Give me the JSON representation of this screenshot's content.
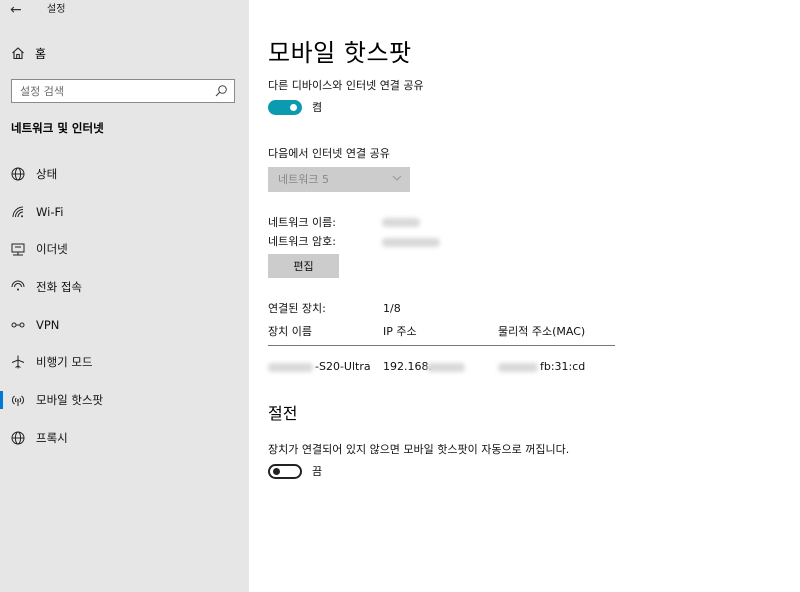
{
  "window": {
    "title": "설정"
  },
  "sidebar": {
    "home_label": "홈",
    "search_placeholder": "설정 검색",
    "section_title": "네트워크 및 인터넷",
    "items": [
      {
        "label": "상태",
        "icon": "globe-status-icon"
      },
      {
        "label": "Wi-Fi",
        "icon": "wifi-icon"
      },
      {
        "label": "이더넷",
        "icon": "ethernet-icon"
      },
      {
        "label": "전화 접속",
        "icon": "dialup-icon"
      },
      {
        "label": "VPN",
        "icon": "vpn-icon"
      },
      {
        "label": "비행기 모드",
        "icon": "airplane-icon"
      },
      {
        "label": "모바일 핫스팟",
        "icon": "hotspot-icon",
        "active": true
      },
      {
        "label": "프록시",
        "icon": "globe-icon"
      }
    ]
  },
  "main": {
    "title": "모바일 핫스팟",
    "share_label": "다른 디바이스와 인터넷 연결 공유",
    "share_toggle_state": "켬",
    "share_from_label": "다음에서 인터넷 연결 공유",
    "share_from_value": "네트워크 5",
    "network_name_label": "네트워크 이름:",
    "network_password_label": "네트워크 암호:",
    "edit_button": "편집",
    "connected_label": "연결된 장치:",
    "connected_value": "1/8",
    "table": {
      "headers": [
        "장치 이름",
        "IP 주소",
        "물리적 주소(MAC)"
      ],
      "rows": [
        {
          "name_visible": "-S20-Ultra",
          "ip_visible": "192.168.",
          "mac_visible": "fb:31:cd"
        }
      ]
    },
    "power_title": "절전",
    "power_desc": "장치가 연결되어 있지 않으면 모바일 핫스팟이 자동으로 꺼집니다.",
    "power_toggle_state": "끔"
  },
  "colors": {
    "accent": "#0a9bb0",
    "sidebar_bg": "#e6e6e6",
    "button_bg": "#cccccc"
  }
}
